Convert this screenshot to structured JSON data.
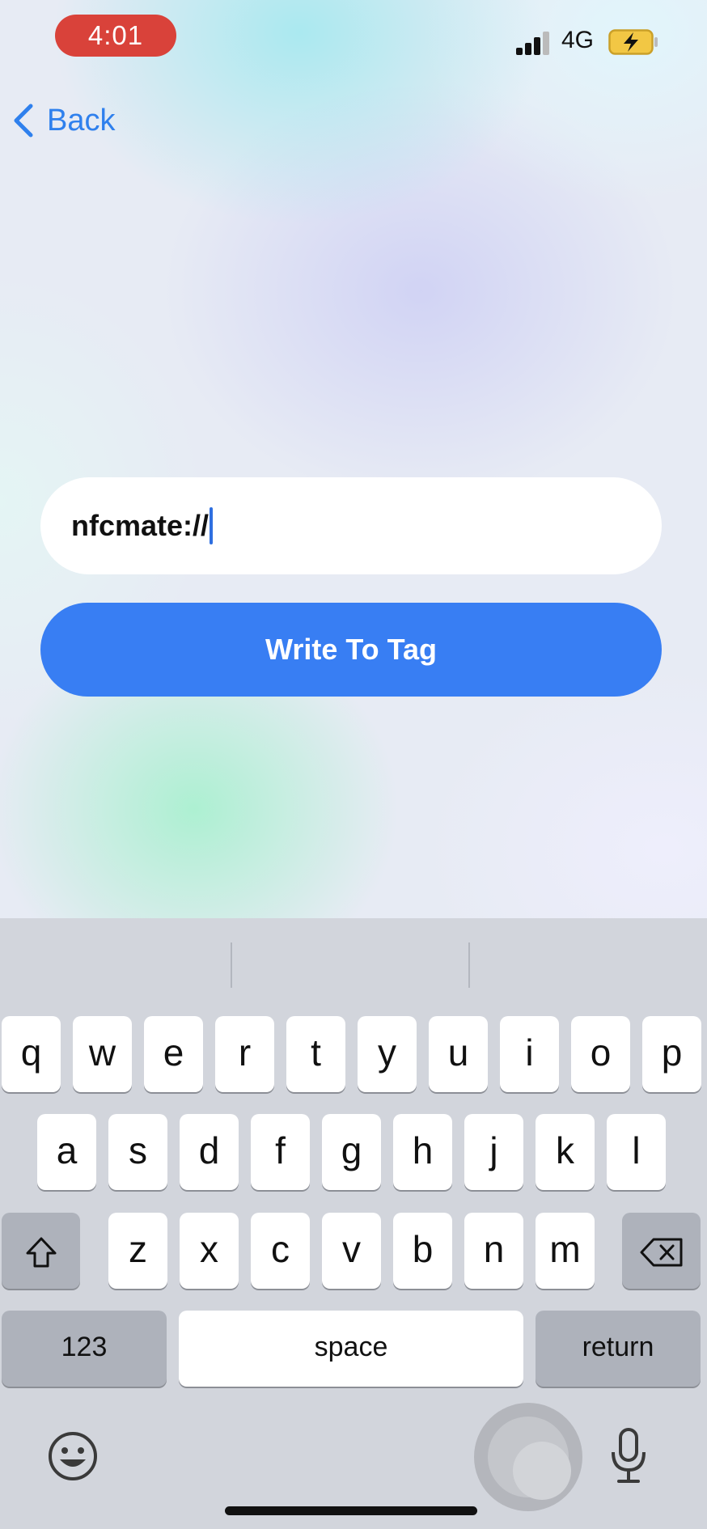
{
  "status_bar": {
    "time": "4:01",
    "network": "4G",
    "signal_bars": 3,
    "signal_bars_total": 4,
    "battery_state": "charging",
    "time_pill_color": "#d9423a"
  },
  "nav": {
    "back_label": "Back"
  },
  "form": {
    "url_value": "nfcmate://",
    "write_button_label": "Write To Tag"
  },
  "colors": {
    "accent": "#387ef3",
    "back_link": "#2f80ed"
  },
  "keyboard": {
    "row1": [
      "q",
      "w",
      "e",
      "r",
      "t",
      "y",
      "u",
      "i",
      "o",
      "p"
    ],
    "row2": [
      "a",
      "s",
      "d",
      "f",
      "g",
      "h",
      "j",
      "k",
      "l"
    ],
    "row3": [
      "z",
      "x",
      "c",
      "v",
      "b",
      "n",
      "m"
    ],
    "numbers_key": "123",
    "space_key": "space",
    "return_key": "return",
    "icons": [
      "shift-icon",
      "delete-icon",
      "emoji-icon",
      "dictation-mic-icon"
    ]
  }
}
